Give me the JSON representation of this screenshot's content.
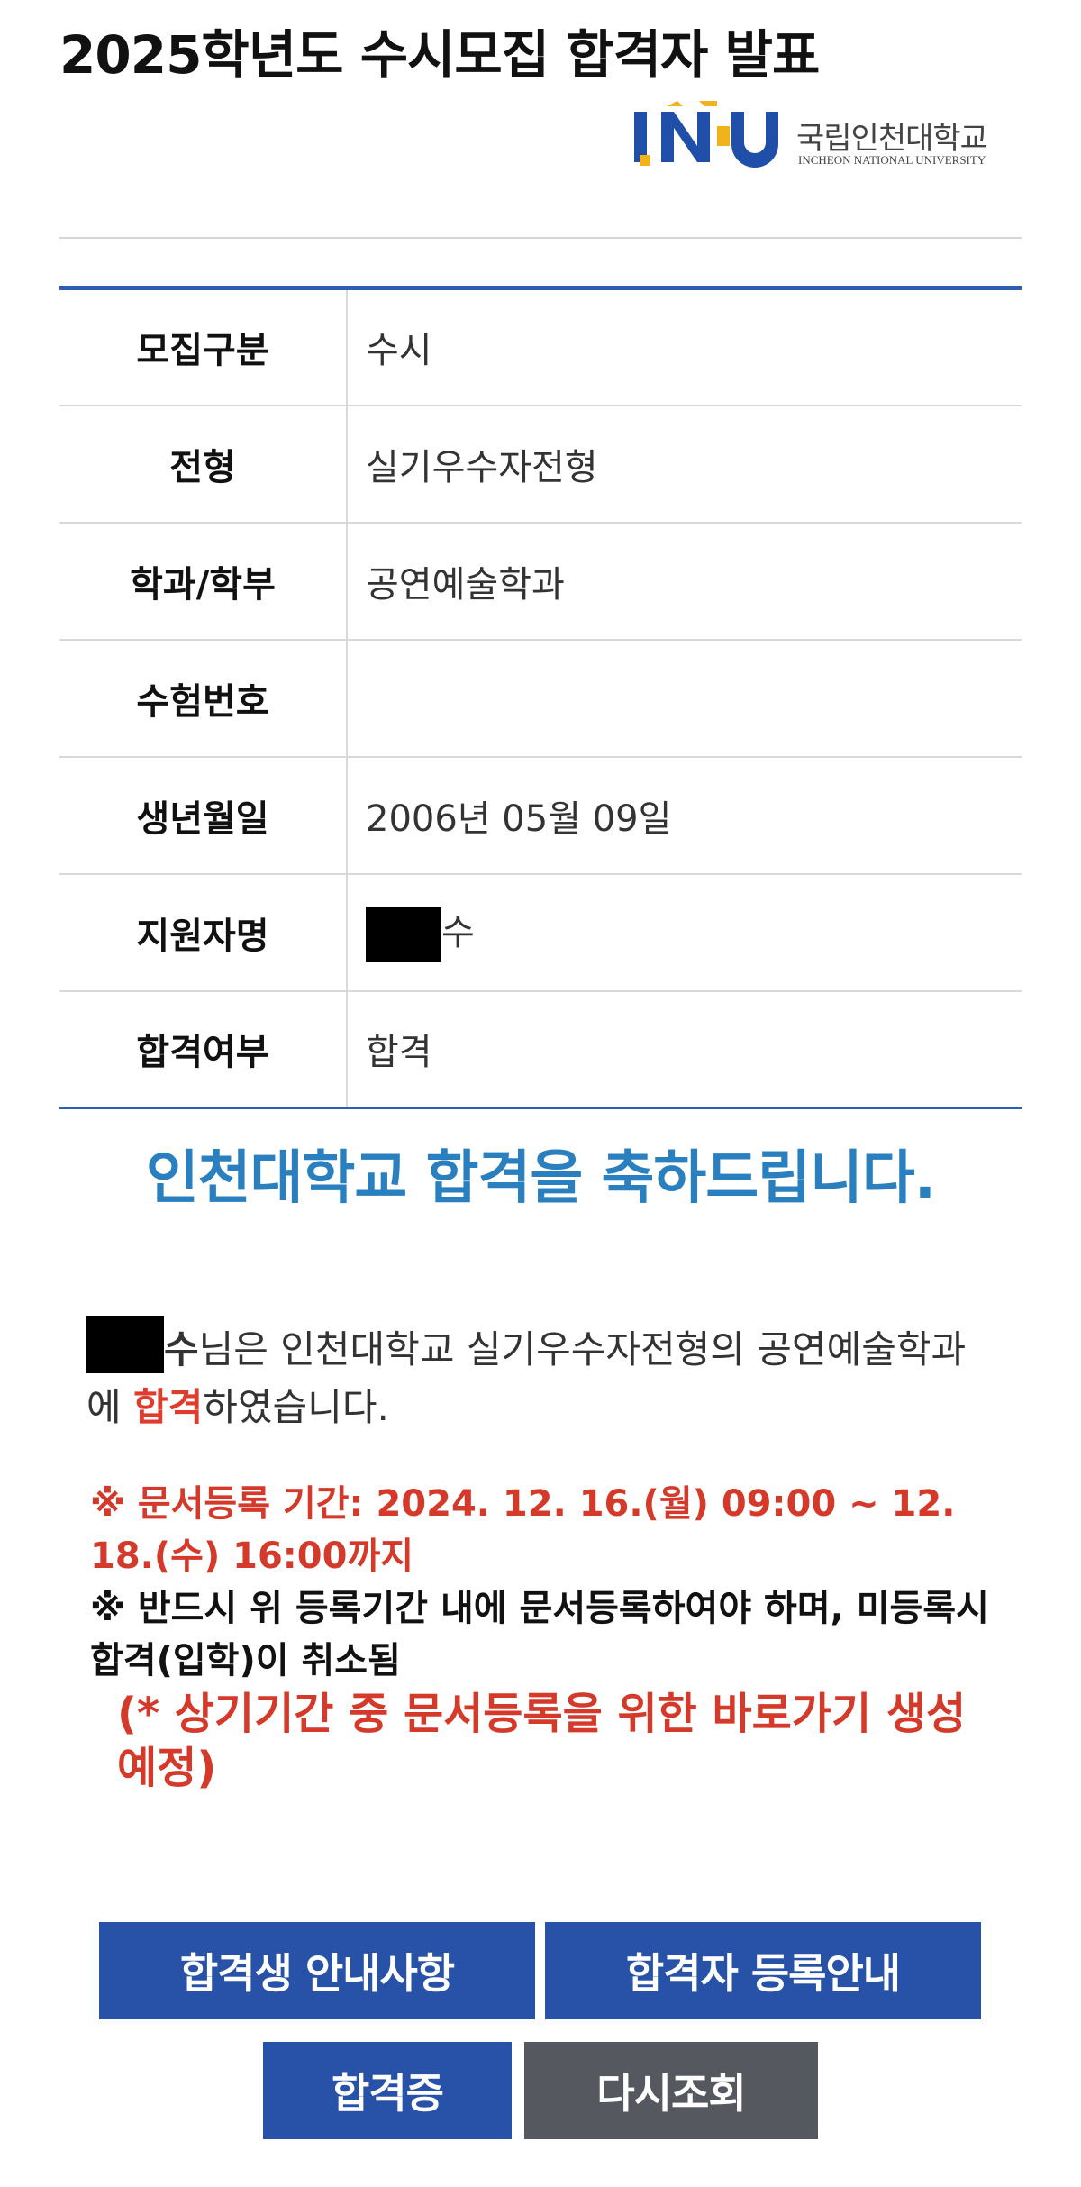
{
  "page": {
    "title": "2025학년도 수시모집 합격자 발표"
  },
  "logo": {
    "mark_letters": [
      "I",
      "N",
      "U"
    ],
    "name": "국립인천대학교",
    "subtitle": "INCHEON NATIONAL UNIVERSITY",
    "colors": {
      "blue": "#1f4fa8",
      "yellow": "#f2b21b"
    }
  },
  "info_table": {
    "rows": [
      {
        "label": "모집구분",
        "value": "수시"
      },
      {
        "label": "전형",
        "value": "실기우수자전형"
      },
      {
        "label": "학과/학부",
        "value": "공연예술학과"
      },
      {
        "label": "수험번호",
        "value": ""
      },
      {
        "label": "생년월일",
        "value": "2006년 05월 09일"
      },
      {
        "label": "지원자명",
        "value": "수"
      },
      {
        "label": "합격여부",
        "value": "합격"
      }
    ]
  },
  "congrats": "인천대학교 합격을 축하드립니다.",
  "result_message": {
    "name_suffix": "수",
    "text_before": "님은 인천대학교 실기우수자전형의 공연예술학과에 ",
    "highlight": "합격",
    "text_after": "하였습니다."
  },
  "notices": {
    "period": "※ 문서등록 기간: 2024. 12. 16.(월) 09:00 ~ 12. 18.(수) 16:00까지",
    "warning": "※ 반드시 위 등록기간 내에 문서등록하여야 하며, 미등록시 합격(입학)이 취소됨",
    "shortcut": "(* 상기기간 중 문서등록을 위한 바로가기 생성 예정)"
  },
  "buttons": {
    "guide": "합격생 안내사항",
    "registration": "합격자 등록안내",
    "certificate": "합격증",
    "retry": "다시조회"
  },
  "colors": {
    "table_border": "#2c5fae",
    "congrats": "#2a7fbf",
    "alert_red": "#d5392a",
    "button_blue": "#2752a8",
    "button_gray": "#55585e"
  }
}
